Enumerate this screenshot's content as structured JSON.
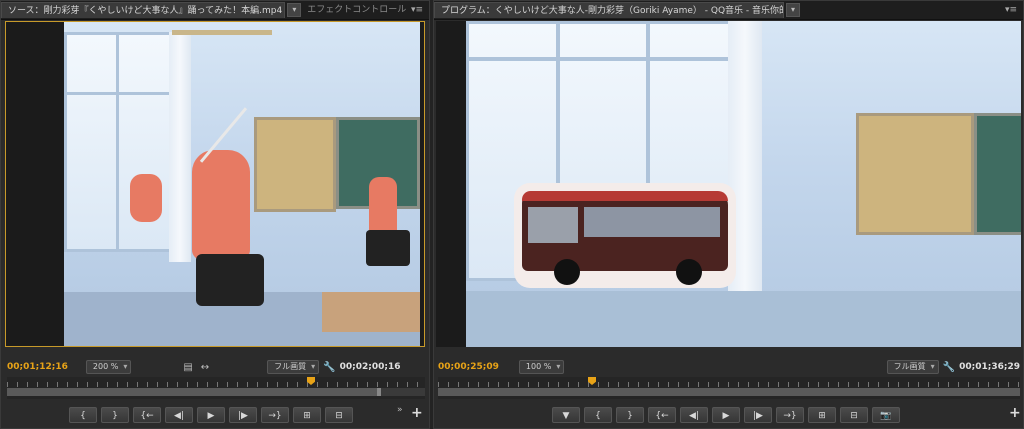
{
  "source": {
    "tab_title": "ソース：剛力彩芽『くやしいけど大事な人』踊ってみた！本編.mp4",
    "tab2_title": "エフェクトコントロール",
    "panel_menu": "▾≡",
    "timecode_current": "00;01;12;16",
    "zoom": "200 %",
    "quality": "フル画質",
    "timecode_duration": "00;02;00;16",
    "buttons": [
      "{",
      "}",
      "{←",
      "◀|",
      "▶",
      "|▶",
      "→}",
      "⊞",
      "⊟"
    ],
    "more": "»",
    "add": "+"
  },
  "program": {
    "tab_title": "プログラム：くやしいけど大事な人-剛力彩芽（Goriki Ayame） - QQ音乐 - 音乐你的生活!",
    "panel_menu": "▾≡",
    "timecode_current": "00;00;25;09",
    "zoom": "100 %",
    "quality": "フル画質",
    "timecode_duration": "00;01;36;29",
    "buttons": [
      "▼",
      "{",
      "}",
      "{←",
      "◀|",
      "▶",
      "|▶",
      "→}",
      "⊞",
      "⊟",
      "📷"
    ],
    "add": "+"
  },
  "icons": {
    "film": "film-strip-icon",
    "fit": "fit-arrows-icon",
    "wrench": "wrench-icon"
  },
  "colors": {
    "accent_timecode": "#e8a317",
    "panel_bg": "#2b2b2b",
    "viewer_border": "#c79a2a"
  }
}
